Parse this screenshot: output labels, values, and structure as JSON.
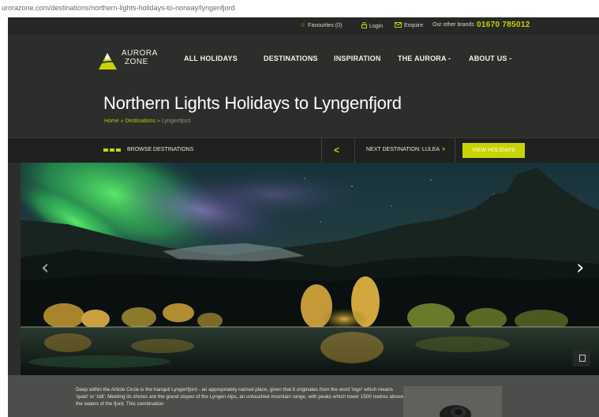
{
  "browser": {
    "url": "urorazone.com/destinations/northern-lights-holidays-to-norway/lyngenfjord"
  },
  "utility_bar": {
    "favourites": "Favourites (0)",
    "login": "Login",
    "enquire": "Enquire",
    "other_brands": "Our other brands",
    "phone": "01670 785012"
  },
  "brand": {
    "logo_line1": "AURORA",
    "logo_line2": "ZONE"
  },
  "nav": {
    "items": [
      {
        "label": "ALL HOLIDAYS"
      },
      {
        "label": "DESTINATIONS"
      },
      {
        "label": "INSPIRATION"
      },
      {
        "label": "THE AURORA -"
      },
      {
        "label": "ABOUT US -"
      }
    ]
  },
  "hero": {
    "title": "Northern Lights Holidays to Lyngenfjord",
    "breadcrumb": {
      "home": "Home",
      "sep1": " » ",
      "destinations": "Destinations",
      "sep2": " » ",
      "current": "Lyngenfjord"
    }
  },
  "destination_bar": {
    "browse_label": "BROWSE DESTINATIONS",
    "prev_arrow": "<",
    "next_label": "NEXT DESTINATION: LULEA",
    "next_arrow": ">",
    "view_button": "VIEW HOLIDAYS"
  },
  "slideshow": {
    "prev_glyph": "‹",
    "next_glyph": "›"
  },
  "intro": {
    "text": "Deep within the Article Circle is the tranquil Lyngenfjord - an appropriately named place, given that it originates from the word 'logn' which means 'quiet' or 'still'. Meeting its shores are the grand slopes of the Lyngen Alps, an untouched mountain range, with peaks which tower 1500 metres above the waters of the fjord. This combination"
  },
  "colors": {
    "accent": "#c8d400",
    "background": "#2c2e2b",
    "bar": "#1f211f",
    "content": "#4b4e4a"
  },
  "icons": {
    "favourites": "star-icon",
    "login": "lock-icon",
    "enquire": "envelope-icon",
    "browse": "grid-blocks-icon",
    "expand": "expand-icon"
  }
}
